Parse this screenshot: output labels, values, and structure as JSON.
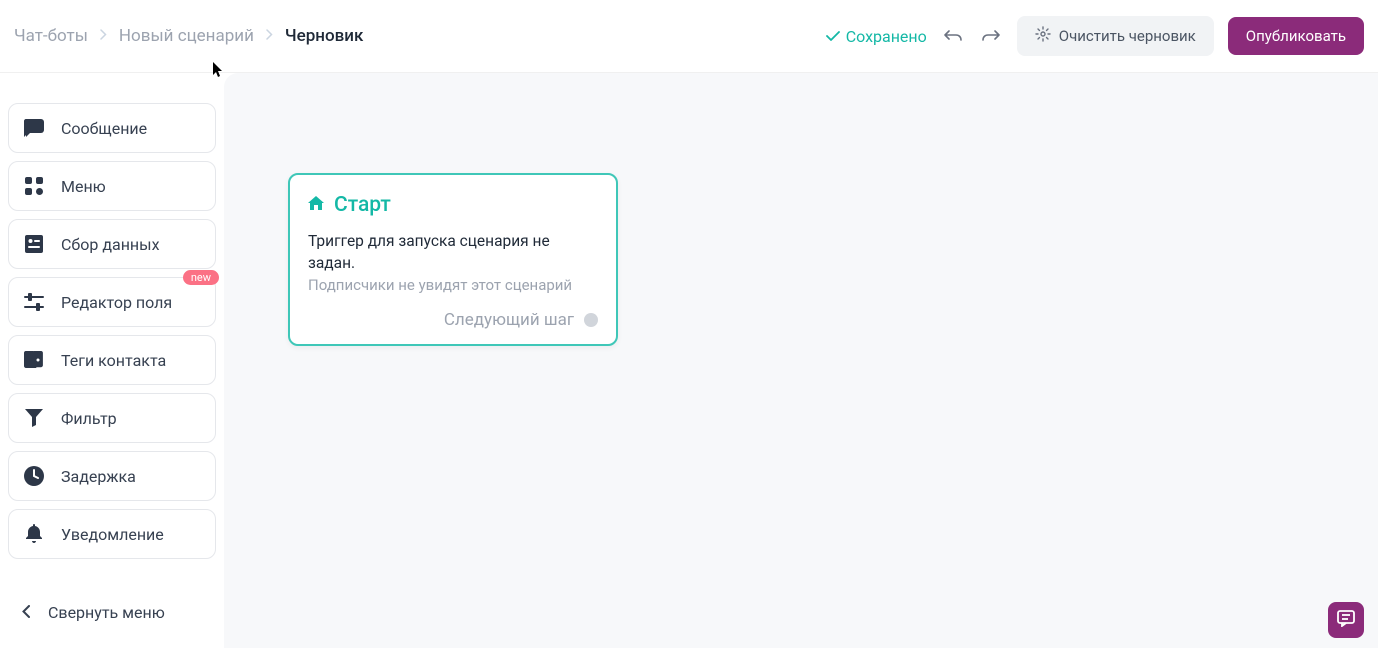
{
  "breadcrumb": {
    "item1": "Чат-боты",
    "item2": "Новый сценарий",
    "item3": "Черновик"
  },
  "header": {
    "saved_label": "Сохранено",
    "clear_label": "Очистить черновик",
    "publish_label": "Опубликовать"
  },
  "sidebar": {
    "items": [
      {
        "label": "Сообщение"
      },
      {
        "label": "Меню"
      },
      {
        "label": "Сбор данных"
      },
      {
        "label": "Редактор поля",
        "badge": "new"
      },
      {
        "label": "Теги контакта"
      },
      {
        "label": "Фильтр"
      },
      {
        "label": "Задержка"
      },
      {
        "label": "Уведомление"
      }
    ],
    "collapse_label": "Свернуть меню"
  },
  "start_node": {
    "title": "Старт",
    "line1": "Триггер для запуска сценария не задан.",
    "line2": "Подписчики не увидят этот сценарий",
    "next_label": "Следующий шаг"
  },
  "colors": {
    "accent_teal": "#14b8a6",
    "brand_purple": "#8b2b7a",
    "badge_red": "#fb7185"
  }
}
